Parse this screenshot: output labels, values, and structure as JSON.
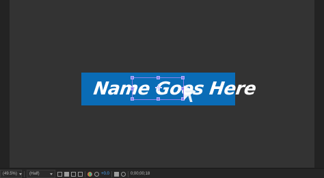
{
  "comp": {
    "title_text": "Name Goes Here",
    "banner_color": "#0a6cb6",
    "selection_color": "#8a82e8",
    "viewer_bg": "#333333"
  },
  "toolbar": {
    "zoom": "(49.5%)",
    "resolution": "(Half)",
    "exposure": "+0.0",
    "timecode": "0;00;00;18",
    "icons": [
      "magnify-icon",
      "region-of-interest-icon",
      "transparency-grid-icon",
      "mask-visibility-icon",
      "guides-icon",
      "color-channel-icon",
      "exposure-reset-icon",
      "camera-snapshot-icon",
      "show-snapshot-icon"
    ]
  }
}
